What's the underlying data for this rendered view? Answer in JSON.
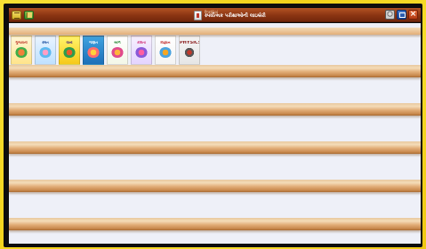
{
  "titlebar": {
    "brand": "Pratilipi",
    "app_name": "સ્પર્ધાત્મક પરીક્ષાઓની લાઇબ્રેરી",
    "icons": [
      "menu-icon",
      "bookshelf-icon",
      "app-logo-icon",
      "settings-icon",
      "window-icon",
      "close-icon"
    ]
  },
  "shelves": {
    "count": 6
  },
  "books": [
    {
      "title": "ગુજરાતી"
    },
    {
      "title": "રમત"
    },
    {
      "title": "વાર્તા"
    },
    {
      "title": "ગણિત"
    },
    {
      "title": "બાળ"
    },
    {
      "title": "કવિતા"
    },
    {
      "title": "વિજ્ઞાન"
    },
    {
      "title": "PHYSICS"
    }
  ]
}
